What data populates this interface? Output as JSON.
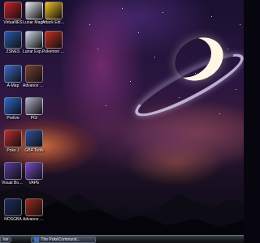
{
  "desktop": {
    "icons": [
      {
        "id": "visualnes",
        "label": "VirtuaNES",
        "icon": "virtuanes-icon",
        "color": "#c8202a"
      },
      {
        "id": "lunar_magic",
        "label": "Lunar Magic",
        "icon": "lunar-magic-icon",
        "color": "#e8e8f0"
      },
      {
        "id": "attack_pro",
        "label": "Attack Editor Pro",
        "icon": "attack-editor-icon",
        "color": "#f0c020"
      },
      {
        "id": "zsnes",
        "label": "ZSNES",
        "icon": "zsnes-icon",
        "color": "#2a5ab0"
      },
      {
        "id": "lunar_expand",
        "label": "Lunar Expand",
        "icon": "lunar-expand-icon",
        "color": "#d0d8e8"
      },
      {
        "id": "pokemon_ep",
        "label": "Pokemon Episode Pro",
        "icon": "pokemon-icon",
        "color": "#c03020"
      },
      {
        "id": "advancemap",
        "label": "A-Map",
        "icon": "advance-map-icon",
        "color": "#3a6ac8"
      },
      {
        "id": "adv_map",
        "label": "Advance Map",
        "icon": "advance-map2-icon",
        "color": "#7a4030"
      },
      {
        "id": "prelive",
        "label": "Prelive",
        "icon": "prelive-icon",
        "color": "#2a6ad0"
      },
      {
        "id": "pgi",
        "label": "PGI",
        "icon": "pgi-icon",
        "color": "#b0b0c8"
      },
      {
        "id": "pj",
        "label": "Poke J",
        "icon": "pokej-icon",
        "color": "#c02a30"
      },
      {
        "id": "gba_tools",
        "label": "GBA Tools",
        "icon": "gba-tools-icon",
        "color": "#3050a0"
      },
      {
        "id": "visual_boy",
        "label": "Visual Boy Advance",
        "icon": "visualboy-icon",
        "color": "#5a3aa0"
      },
      {
        "id": "vape",
        "label": "VAPE",
        "icon": "vape-icon",
        "color": "#7a4ac8"
      },
      {
        "id": "nosgba",
        "label": "NOSGBA",
        "icon": "nosgba-icon",
        "color": "#1a2a60"
      },
      {
        "id": "adv_starter",
        "label": "Advance Starter",
        "icon": "advance-starter-icon",
        "color": "#9a2a1a"
      }
    ]
  },
  "taskbar": {
    "start_label": "ive",
    "window_label": "The PokéCommunit..."
  }
}
